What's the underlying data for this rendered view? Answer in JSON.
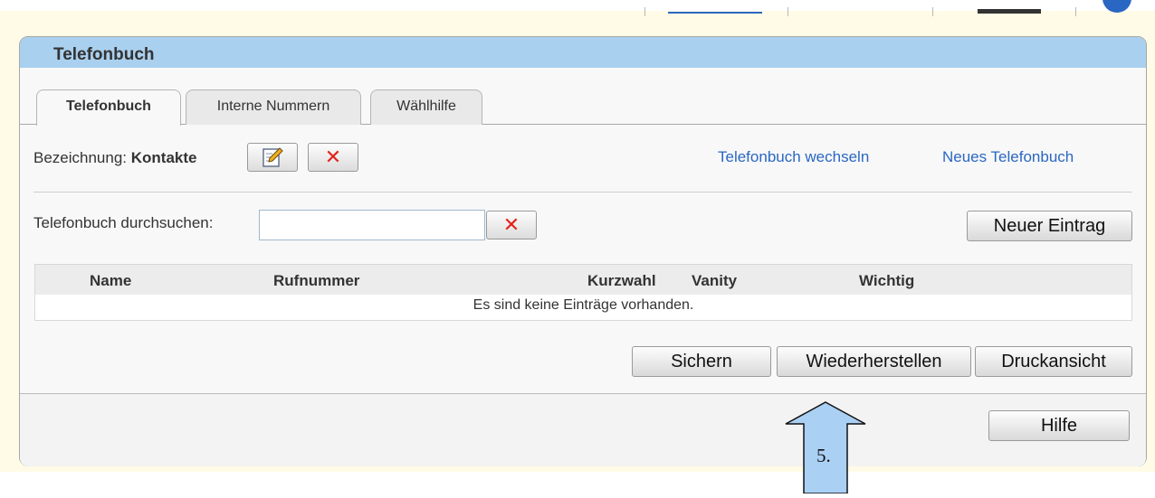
{
  "panel": {
    "title": "Telefonbuch"
  },
  "tabs": [
    {
      "label": "Telefonbuch",
      "active": true
    },
    {
      "label": "Interne Nummern",
      "active": false
    },
    {
      "label": "Wählhilfe",
      "active": false
    }
  ],
  "phonebook": {
    "name_label": "Bezeichnung:",
    "name_value": "Kontakte",
    "edit_icon": "edit-icon",
    "delete_icon": "delete-x-icon",
    "delete_glyph": "✕",
    "switch_link": "Telefonbuch wechseln",
    "new_link": "Neues Telefonbuch"
  },
  "search": {
    "label": "Telefonbuch durchsuchen:",
    "value": "",
    "clear_icon": "clear-x-icon",
    "clear_glyph": "✕",
    "new_entry_label": "Neuer Eintrag"
  },
  "table": {
    "columns": [
      "Name",
      "Rufnummer",
      "Kurzwahl",
      "Vanity",
      "Wichtig"
    ],
    "empty_message": "Es sind keine Einträge vorhanden."
  },
  "actions": {
    "save_label": "Sichern",
    "restore_label": "Wiederherstellen",
    "print_label": "Druckansicht",
    "help_label": "Hilfe"
  },
  "annotation": {
    "step_label": "5."
  },
  "colors": {
    "header": "#a9d0ef",
    "link": "#2a67c2",
    "delete": "#e2231a",
    "background": "#fffbe6"
  }
}
